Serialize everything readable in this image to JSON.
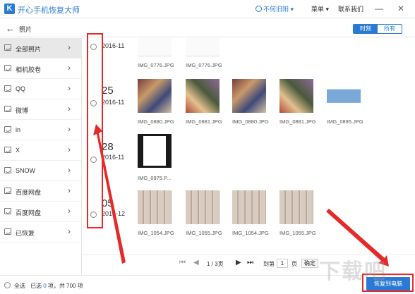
{
  "app": {
    "logo_letter": "K",
    "title": "开心手机恢复大师"
  },
  "titlebar": {
    "user_label": "不何旧阳",
    "menu_label": "菜单",
    "contact_label": "联系我们",
    "minimize_glyph": "—",
    "close_glyph": "✕"
  },
  "subheader": {
    "back_glyph": "←",
    "crumb": "照片",
    "tabs": [
      {
        "label": "时刻",
        "active": true
      },
      {
        "label": "所有",
        "active": false
      }
    ]
  },
  "sidebar": {
    "items": [
      {
        "label": "全部照片",
        "active": true
      },
      {
        "label": "相机胶卷",
        "active": false
      },
      {
        "label": "QQ",
        "active": false
      },
      {
        "label": "微博",
        "active": false
      },
      {
        "label": "in",
        "active": false
      },
      {
        "label": "X",
        "active": false
      },
      {
        "label": "SNOW",
        "active": false
      },
      {
        "label": "百度网盘",
        "active": false
      },
      {
        "label": "百度网盘",
        "active": false
      },
      {
        "label": "已恢复",
        "active": false
      }
    ],
    "chevron_glyph": "›"
  },
  "groups": [
    {
      "day": "",
      "ym": "2016-11",
      "photos": [
        {
          "name": "IMG_0776.JPG"
        },
        {
          "name": "IMG_0776.JPG"
        }
      ]
    },
    {
      "day": "25",
      "ym": "2016-11",
      "photos": [
        {
          "name": "IMG_0880.JPG"
        },
        {
          "name": "IMG_0881.JPG"
        },
        {
          "name": "IMG_0880.JPG"
        },
        {
          "name": "IMG_0881.JPG"
        },
        {
          "name": "IMG_0895.JPG"
        }
      ]
    },
    {
      "day": "28",
      "ym": "2016-11",
      "photos": [
        {
          "name": "IMG_0975.P..."
        }
      ]
    },
    {
      "day": "05",
      "ym": "2016-12",
      "photos": [
        {
          "name": "IMG_1054.JPG"
        },
        {
          "name": "IMG_1055.JPG"
        },
        {
          "name": "IMG_1054.JPG"
        },
        {
          "name": "IMG_1055.JPG"
        }
      ]
    }
  ],
  "pager": {
    "first_glyph": "⏮",
    "prev_glyph": "◀",
    "page_info": "1 / 3页",
    "next_glyph": "▶",
    "last_glyph": "⏭",
    "goto_label": "到第",
    "page_value": "1",
    "page_suffix": "页",
    "confirm_label": "确定"
  },
  "footer": {
    "select_all": "全选",
    "selected_prefix": "已选",
    "selected_count": "0",
    "selected_mid": "项，共",
    "total": "700",
    "total_suffix": "项",
    "recover_label": "恢复到电脑"
  },
  "watermark": "下载吧",
  "colors": {
    "accent": "#2a7ad5",
    "annotation": "#e62a2a"
  }
}
